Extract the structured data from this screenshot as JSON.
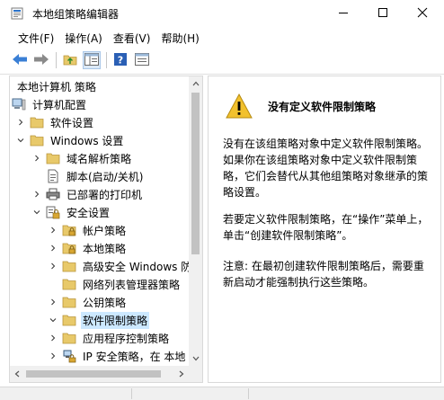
{
  "window": {
    "title": "本地组策略编辑器",
    "icon": "policy-editor-icon"
  },
  "menu": [
    {
      "label": "文件(F)"
    },
    {
      "label": "操作(A)"
    },
    {
      "label": "查看(V)"
    },
    {
      "label": "帮助(H)"
    }
  ],
  "toolbar": {
    "icons": [
      "back-arrow-icon",
      "forward-arrow-icon",
      "up-folder-icon",
      "show-hide-tree-icon",
      "help-icon",
      "properties-icon"
    ]
  },
  "tree": {
    "items": [
      {
        "label": "本地计算机 策略",
        "level": 0,
        "chevron": "none",
        "icon": "none"
      },
      {
        "label": "计算机配置",
        "level": 0,
        "chevron": "none",
        "icon": "computer-icon"
      },
      {
        "label": "软件设置",
        "level": 1,
        "chevron": "right",
        "icon": "folder-icon"
      },
      {
        "label": "Windows 设置",
        "level": 1,
        "chevron": "down",
        "icon": "folder-icon"
      },
      {
        "label": "域名解析策略",
        "level": 2,
        "chevron": "right",
        "icon": "folder-icon"
      },
      {
        "label": "脚本(启动/关机)",
        "level": 2,
        "chevron": "none",
        "icon": "script-icon"
      },
      {
        "label": "已部署的打印机",
        "level": 2,
        "chevron": "right",
        "icon": "printer-icon"
      },
      {
        "label": "安全设置",
        "level": 2,
        "chevron": "down",
        "icon": "security-icon"
      },
      {
        "label": "帐户策略",
        "level": 3,
        "chevron": "right",
        "icon": "lock-folder-icon"
      },
      {
        "label": "本地策略",
        "level": 3,
        "chevron": "right",
        "icon": "lock-folder-icon"
      },
      {
        "label": "高级安全 Windows 防",
        "level": 3,
        "chevron": "right",
        "icon": "folder-icon"
      },
      {
        "label": "网络列表管理器策略",
        "level": 3,
        "chevron": "none",
        "icon": "folder-icon"
      },
      {
        "label": "公钥策略",
        "level": 3,
        "chevron": "right",
        "icon": "folder-icon"
      },
      {
        "label": "软件限制策略",
        "level": 3,
        "chevron": "down",
        "icon": "folder-icon",
        "selected": true
      },
      {
        "label": "应用程序控制策略",
        "level": 3,
        "chevron": "right",
        "icon": "folder-icon"
      },
      {
        "label": "IP 安全策略，在 本地",
        "level": 3,
        "chevron": "right",
        "icon": "ip-security-icon"
      }
    ]
  },
  "detail": {
    "heading": "没有定义软件限制策略",
    "para1": "没有在该组策略对象中定义软件限制策略。如果你在该组策略对象中定义软件限制策略，它们会替代从其他组策略对象继承的策略设置。",
    "para2": "若要定义软件限制策略，在“操作”菜单上，单击“创建软件限制策略”。",
    "para3": "注意: 在最初创建软件限制策略后，需要重新启动才能强制执行这些策略。"
  },
  "colors": {
    "selection": "#cce8ff",
    "folder": "#e8c96a",
    "back_arrow": "#3a7fd5",
    "warning": "#f2c12e"
  }
}
